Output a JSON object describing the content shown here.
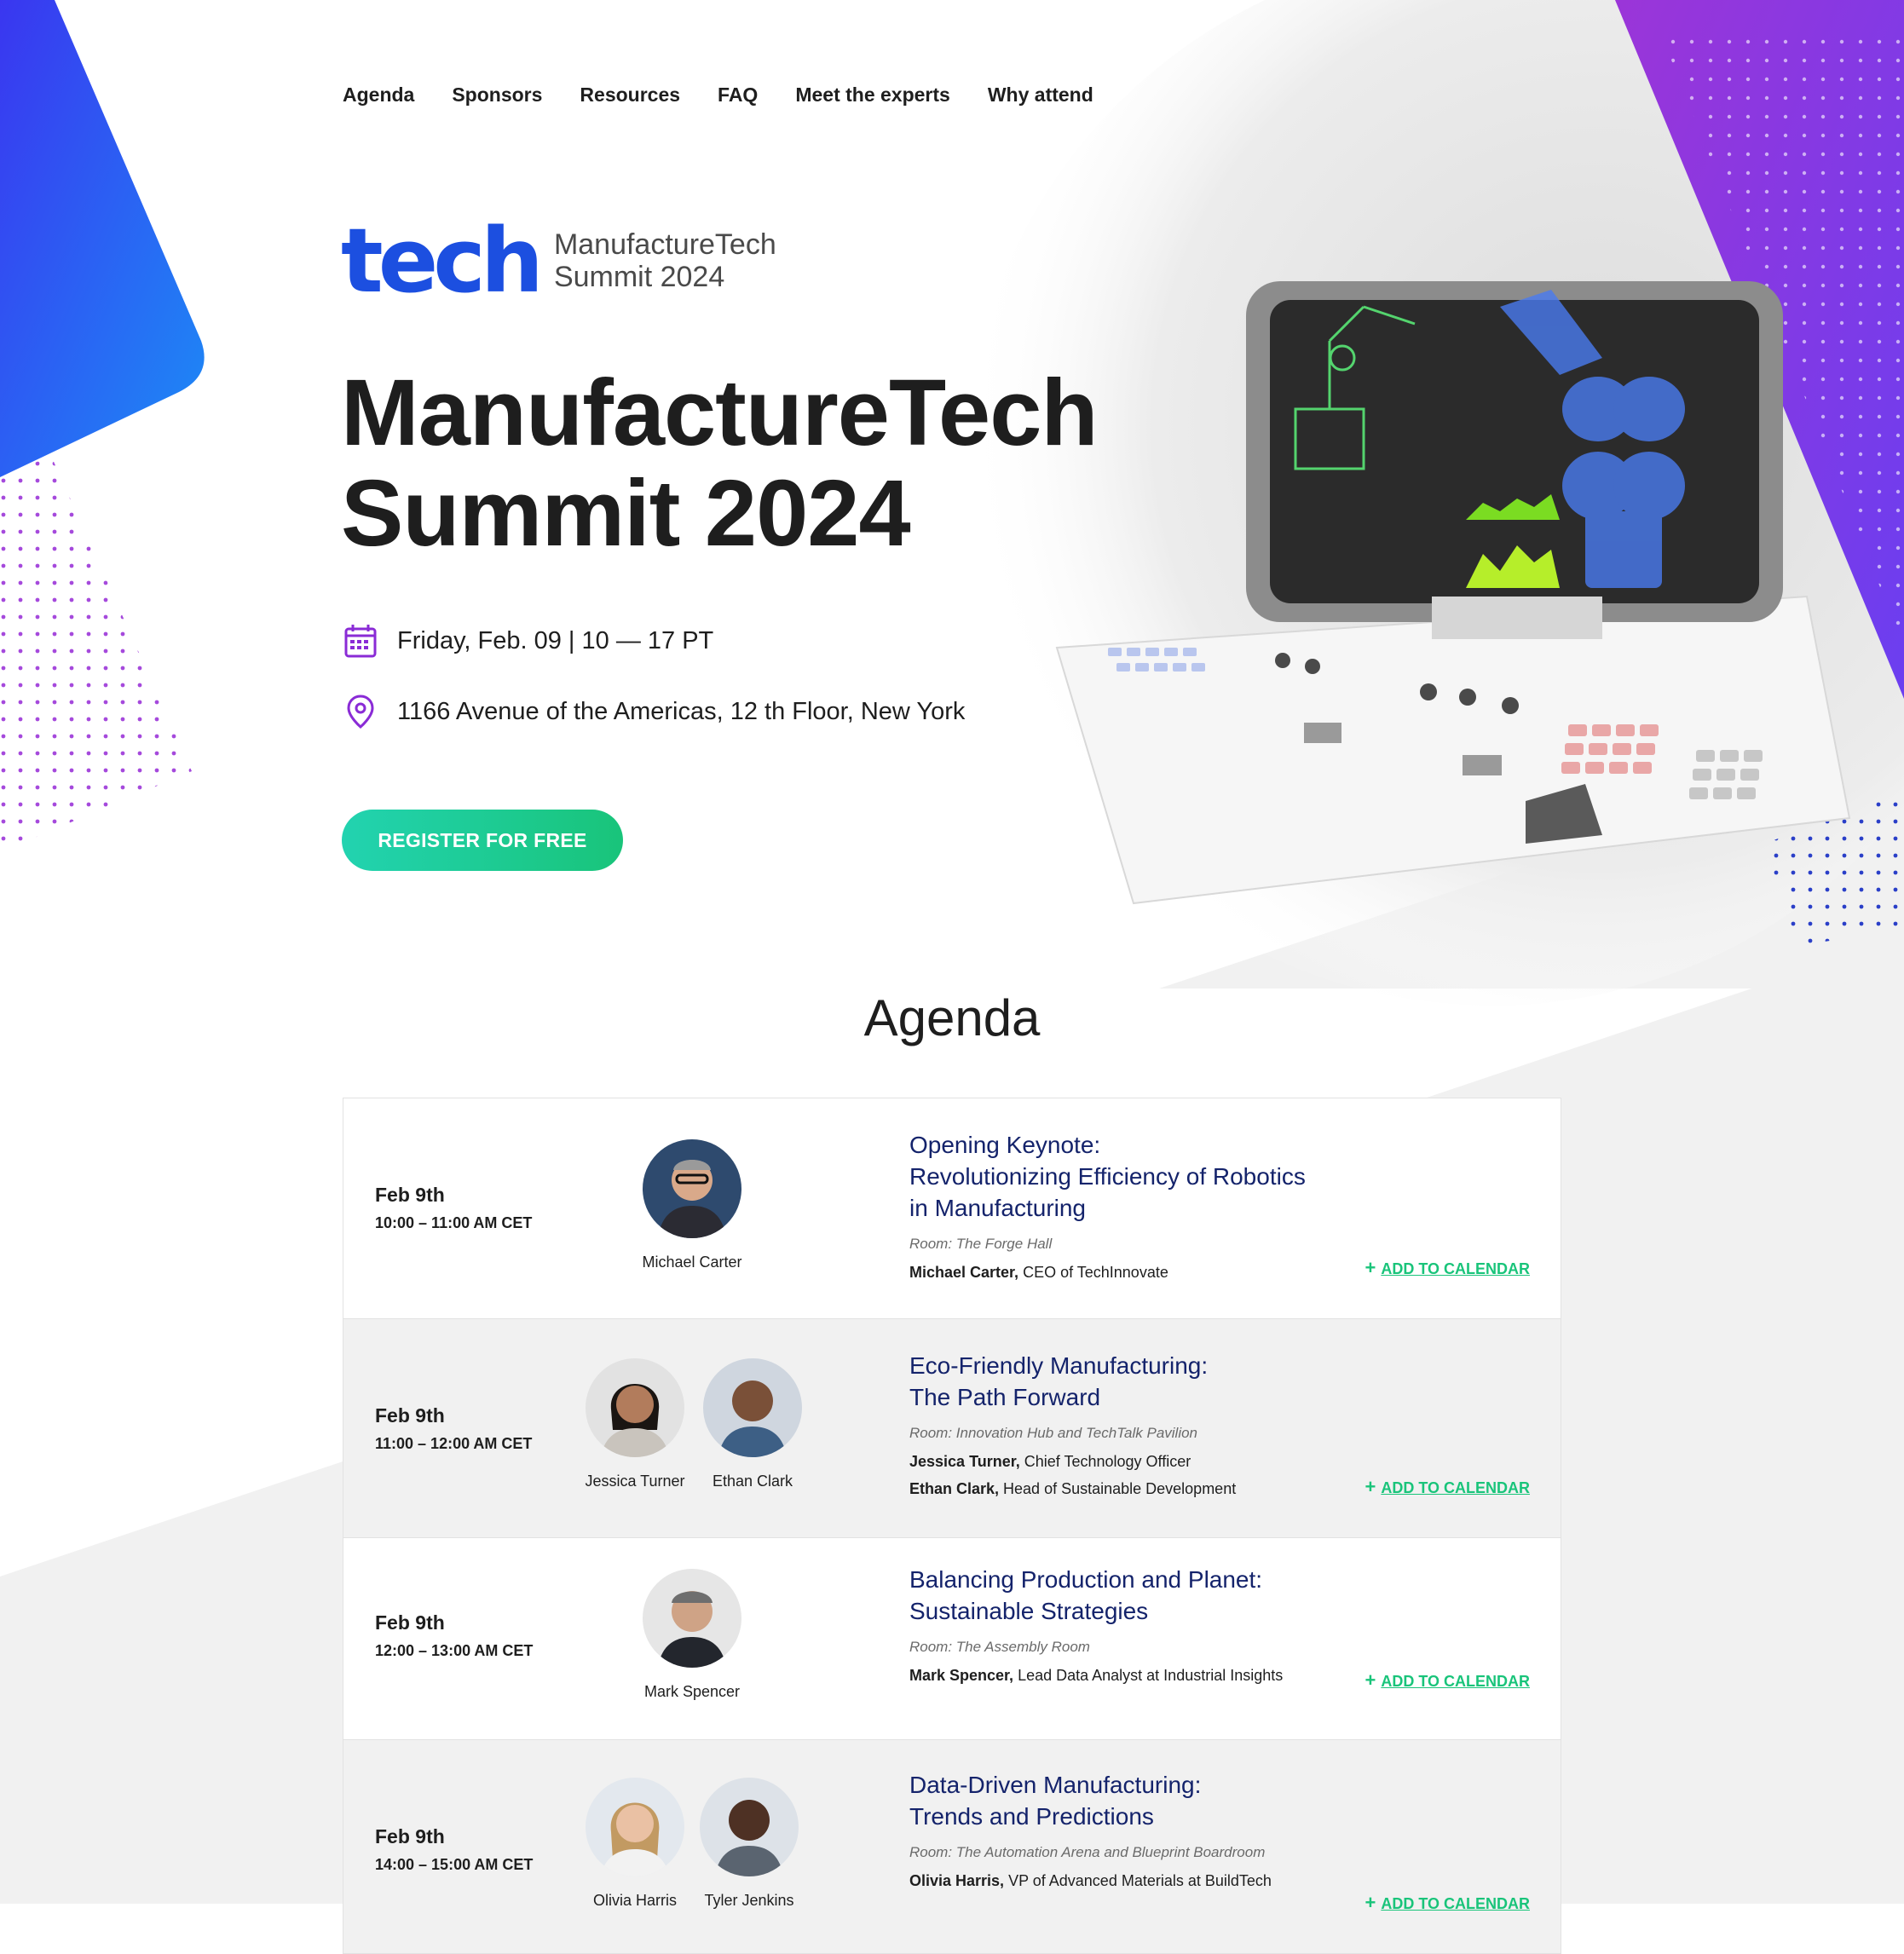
{
  "nav": {
    "items": [
      "Agenda",
      "Sponsors",
      "Resources",
      "FAQ",
      "Meet the experts",
      "Why attend"
    ]
  },
  "logo": {
    "mark": "tech",
    "line1": "ManufactureTech",
    "line2": "Summit 2024"
  },
  "hero": {
    "title_line1": "ManufactureTech",
    "title_line2": "Summit 2024",
    "date": "Friday, Feb. 09 | 10 — 17 PT",
    "location": "1166 Avenue of the Americas, 12 th Floor, New York",
    "register_label": "REGISTER FOR FREE",
    "calendar_icon": "calendar-icon",
    "location_icon": "map-pin-icon"
  },
  "agenda": {
    "title": "Agenda",
    "calendar_label": "ADD TO CALENDAR",
    "calendar_plus": "+",
    "sessions": [
      {
        "date": "Feb 9th",
        "time": "10:00 – 11:00 AM CET",
        "speakers": [
          "Michael Carter"
        ],
        "title_lines": [
          "Opening Keynote:",
          "Revolutionizing Efficiency of Robotics",
          "in Manufacturing"
        ],
        "room": "Room: The Forge Hall",
        "speaker_lines": [
          {
            "name": "Michael Carter,",
            "role": " CEO of TechInnovate"
          }
        ]
      },
      {
        "date": "Feb 9th",
        "time": "11:00 – 12:00 AM CET",
        "speakers": [
          "Jessica Turner",
          "Ethan Clark"
        ],
        "title_lines": [
          "Eco-Friendly Manufacturing:",
          "The Path Forward"
        ],
        "room": "Room: Innovation Hub and TechTalk Pavilion",
        "speaker_lines": [
          {
            "name": "Jessica Turner,",
            "role": " Chief Technology Officer"
          },
          {
            "name": "Ethan Clark,",
            "role": " Head of Sustainable Development"
          }
        ]
      },
      {
        "date": "Feb 9th",
        "time": "12:00 – 13:00 AM CET",
        "speakers": [
          "Mark Spencer"
        ],
        "title_lines": [
          "Balancing Production and Planet:",
          "Sustainable Strategies"
        ],
        "room": "Room: The Assembly Room",
        "speaker_lines": [
          {
            "name": "Mark Spencer,",
            "role": " Lead Data Analyst at Industrial Insights"
          }
        ]
      },
      {
        "date": "Feb 9th",
        "time": "14:00 – 15:00 AM CET",
        "speakers": [
          "Olivia Harris",
          "Tyler Jenkins"
        ],
        "title_lines": [
          "Data-Driven Manufacturing:",
          "Trends and Predictions"
        ],
        "room": "Room: The Automation Arena and Blueprint Boardroom",
        "speaker_lines": [
          {
            "name": "Olivia Harris,",
            "role": " VP of Advanced Materials at BuildTech"
          }
        ]
      }
    ]
  },
  "colors": {
    "accent_green": "#19c47a",
    "title_navy": "#14236b",
    "brand_blue": "#1c4fe0",
    "brand_purple": "#8a2bd6"
  }
}
